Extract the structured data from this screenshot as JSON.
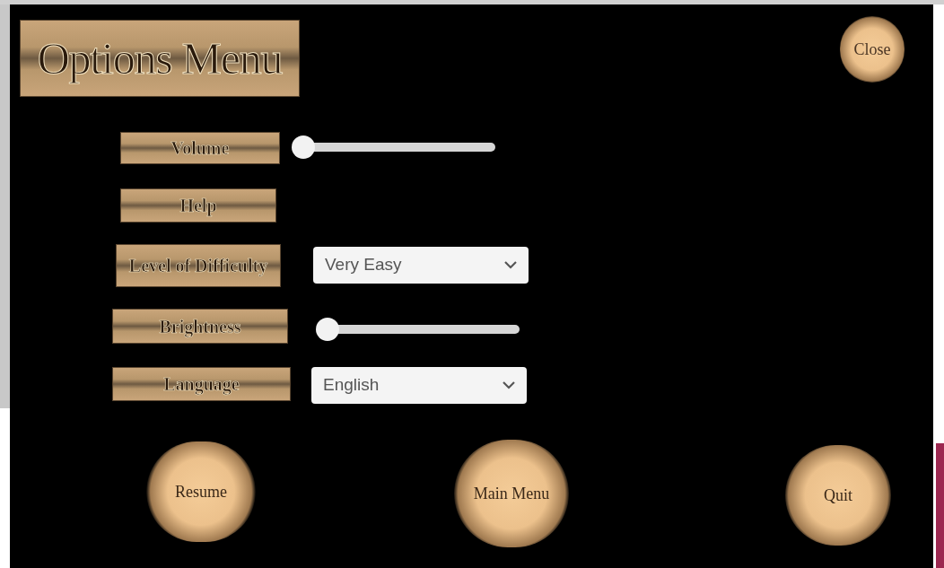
{
  "title": "Options Menu",
  "close_button": "Close",
  "settings": [
    {
      "kind": "slider",
      "label": "Volume",
      "level": 0
    },
    {
      "kind": "button",
      "label": "Help"
    },
    {
      "kind": "dropdown",
      "label": "Level of Difficulty",
      "value": "Very Easy"
    },
    {
      "kind": "slider",
      "label": "Brightness",
      "level": 0
    },
    {
      "kind": "dropdown",
      "label": "Language",
      "value": "English"
    }
  ],
  "bottom_buttons": [
    "Resume",
    "Main Menu",
    "Quit"
  ]
}
